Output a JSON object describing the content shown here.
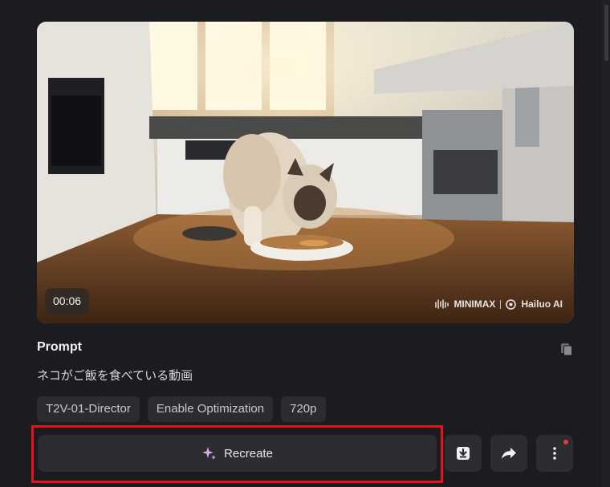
{
  "video": {
    "duration": "00:06",
    "watermark": {
      "brand1": "MINIMAX",
      "brand2": "Hailuo AI"
    }
  },
  "prompt": {
    "title": "Prompt",
    "text": "ネコがご飯を食べている動画"
  },
  "tags": [
    "T2V-01-Director",
    "Enable Optimization",
    "720p"
  ],
  "actions": {
    "recreate_label": "Recreate",
    "download_icon": "download-icon",
    "share_icon": "share-icon",
    "more_icon": "more-vertical-icon"
  },
  "colors": {
    "background": "#1b1c1f",
    "button": "#2c2d31",
    "highlight": "#e3141b",
    "sparkle": "#d9a6f2",
    "notification_dot": "#e83a3a"
  }
}
